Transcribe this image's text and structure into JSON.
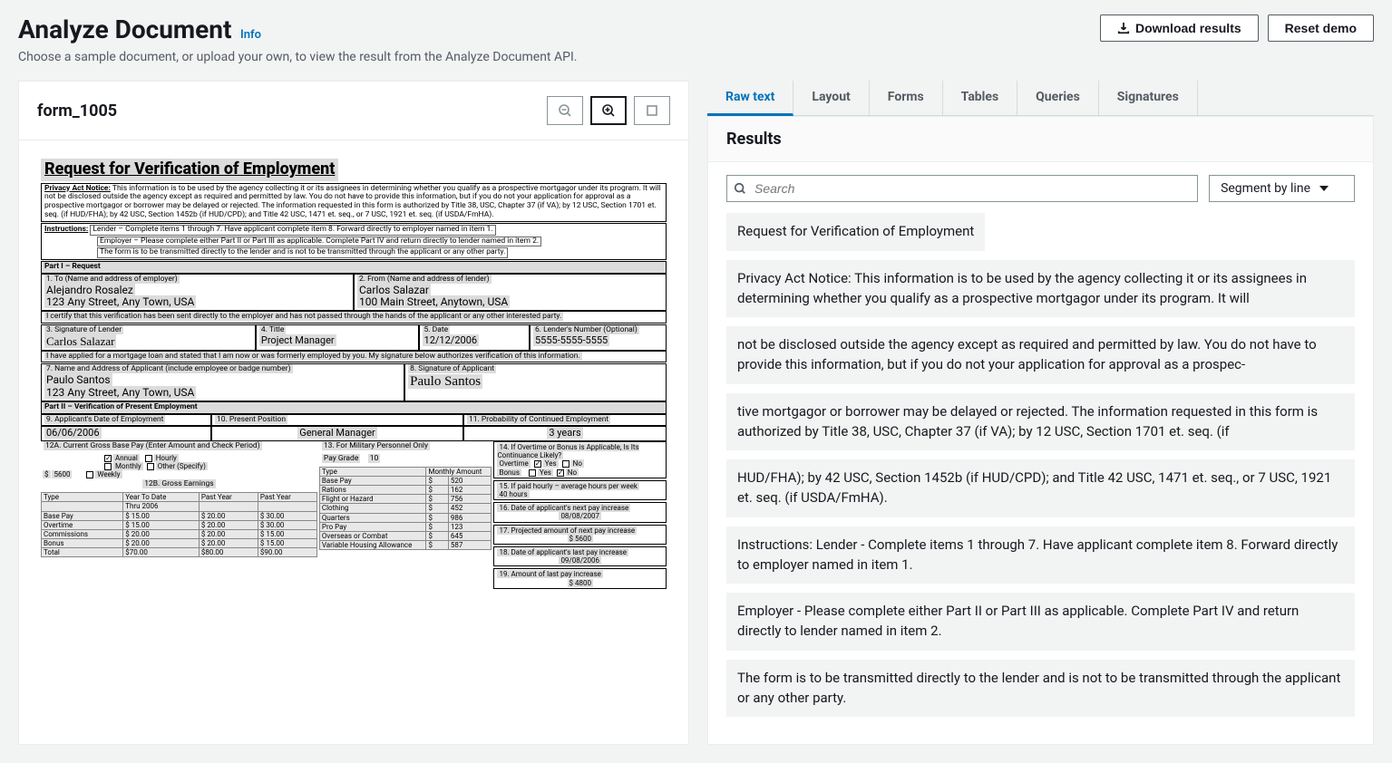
{
  "header": {
    "title": "Analyze Document",
    "info_label": "Info",
    "subtitle": "Choose a sample document, or upload your own, to view the result from the Analyze Document API.",
    "download_label": "Download results",
    "reset_label": "Reset demo"
  },
  "left": {
    "doc_name": "form_1005"
  },
  "document": {
    "title": "Request for Verification of Employment",
    "privacy_label": "Privacy Act Notice:",
    "privacy_text": "This information is to be used by the agency collecting it or its assignees in determining whether you qualify as a prospective mortgagor under its program. It will not be disclosed outside the agency except as required and permitted by law. You do not have to provide this information, but if you do not your application for approval as a prospective mortgagor or borrower may be delayed or rejected. The information requested in this form is authorized by Title 38, USC, Chapter 37 (if VA); by 12 USC, Section 1701 et. seq. (if HUD/FHA); by 42 USC, Section 1452b (if HUD/CPD); and Title 42 USC, 1471 et. seq., or 7 USC, 1921 et. seq. (if USDA/FmHA).",
    "instructions_label": "Instructions:",
    "instr_lender": "Lender – Complete items 1 through 7. Have applicant complete item 8. Forward directly to employer named in item 1.",
    "instr_employer": "Employer – Please complete either Part II or Part III as applicable. Complete Part IV and return directly to lender named in item 2.",
    "instr_form": "The form is to be transmitted directly to the lender and is not to be transmitted through the applicant or any other party.",
    "part1_label": "Part I – Request",
    "f1_label": "1. To (Name and address of employer)",
    "f1_name": "Alejandro Rosalez",
    "f1_addr": "123 Any Street, Any Town, USA",
    "f2_label": "2. From (Name and address of lender)",
    "f2_name": "Carlos Salazar",
    "f2_addr": "100 Main Street, Anytown, USA",
    "cert_text": "I certify that this verification has been sent directly to the employer and has not passed through the hands of the applicant or any other interested party.",
    "f3_label": "3. Signature of Lender",
    "f3_sig": "Carlos Salazar",
    "f4_label": "4. Title",
    "f4_val": "Project Manager",
    "f5_label": "5. Date",
    "f5_val": "12/12/2006",
    "f6_label": "6. Lender's Number (Optional)",
    "f6_val": "5555-5555-5555",
    "applied_text": "I have applied for a mortgage loan and stated that I am now or was formerly employed by you. My signature below authorizes verification of this information.",
    "f7_label": "7. Name and Address of Applicant (include employee or badge number)",
    "f7_name": "Paulo Santos",
    "f7_addr": "123 Any Street, Any Town, USA",
    "f8_label": "8. Signature of Applicant",
    "f8_sig": "Paulo Santos",
    "part2_label": "Part II – Verification of Present Employment",
    "f9_label": "9. Applicant's Date of Employment",
    "f9_val": "06/06/2006",
    "f10_label": "10. Present Position",
    "f10_val": "General Manager",
    "f11_label": "11. Probability of Continued Employment",
    "f11_val": "3 years",
    "f12a_label": "12A. Current Gross Base Pay (Enter Amount and Check Period)",
    "cb_annual": "Annual",
    "cb_hourly": "Hourly",
    "cb_monthly": "Monthly",
    "cb_other": "Other (Specify)",
    "cb_weekly": "Weekly",
    "f12a_amount": "5600",
    "f12b_label": "12B. Gross Earnings",
    "col_type": "Type",
    "col_ytd": "Year To Date",
    "col_past": "Past Year",
    "col_past2": "Past Year",
    "ytd_thru": "Thru",
    "ytd_year": "2006",
    "row_basepay": "Base Pay",
    "bp_ytd": "15.00",
    "bp_py1": "20.00",
    "bp_py2": "30.00",
    "row_overtime": "Overtime",
    "ot_ytd": "15.00",
    "ot_py1": "20.00",
    "ot_py2": "30.00",
    "row_comm": "Commissions",
    "cm_ytd": "20.00",
    "cm_py1": "20.00",
    "cm_py2": "15.00",
    "row_bonus": "Bonus",
    "bn_ytd": "20.00",
    "bn_py1": "20.00",
    "bn_py2": "15.00",
    "row_total": "Total",
    "tt_ytd": "70.00",
    "tt_py1": "80.00",
    "tt_py2": "90.00",
    "f13_label": "13. For Military Personnel Only",
    "pg_label": "Pay Grade",
    "pg_val": "10",
    "mil_type": "Type",
    "mil_ma": "Monthly Amount",
    "mil_basepay": "Base Pay",
    "mil_bp_v": "520",
    "mil_rations": "Rations",
    "mil_ra_v": "162",
    "mil_flight": "Flight or Hazard",
    "mil_fh_v": "756",
    "mil_clothing": "Clothing",
    "mil_cl_v": "452",
    "mil_quarters": "Quarters",
    "mil_qt_v": "986",
    "mil_propay": "Pro Pay",
    "mil_pp_v": "123",
    "mil_overseas": "Overseas or Combat",
    "mil_oc_v": "645",
    "mil_vha": "Variable Housing Allowance",
    "mil_vha_v": "587",
    "f14_label": "14. If Overtime or Bonus is Applicable, Is Its Continuance Likely?",
    "f14_ot": "Overtime",
    "f14_bn": "Bonus",
    "yes": "Yes",
    "no": "No",
    "f15_label": "15. If paid hourly – average hours per week",
    "f15_val": "40 hours",
    "f16_label": "16. Date of applicant's next pay increase",
    "f16_val": "08/08/2007",
    "f17_label": "17. Projected amount of next pay increase",
    "f17_val": "$ 5600",
    "f18_label": "18. Date of applicant's last pay increase",
    "f18_val": "09/08/2006",
    "f19_label": "19. Amount of last pay increase",
    "f19_val": "$ 4800"
  },
  "tabs": {
    "raw": "Raw text",
    "layout": "Layout",
    "forms": "Forms",
    "tables": "Tables",
    "queries": "Queries",
    "signatures": "Signatures"
  },
  "results": {
    "header": "Results",
    "search_placeholder": "Search",
    "segment_label": "Segment by line",
    "items": [
      "Request for Verification of Employment",
      "Privacy Act Notice: This information is to be used by the agency collecting it or its assignees in determining whether you qualify as a prospective mortgagor under its program. It will",
      "not be disclosed outside the agency except as required and permitted by law. You do not have to provide this information, but if you do not your application for approval as a prospec-",
      "tive mortgagor or borrower may be delayed or rejected. The information requested in this form is authorized by Title 38, USC, Chapter 37 (if VA); by 12 USC, Section 1701 et. seq. (if",
      "HUD/FHA); by 42 USC, Section 1452b (if HUD/CPD); and Title 42 USC, 1471 et. seq., or 7 USC, 1921 et. seq. (if USDA/FmHA).",
      "Instructions: Lender - Complete items 1 through 7. Have applicant complete item 8. Forward directly to employer named in item 1.",
      "Employer - Please complete either Part II or Part III as applicable. Complete Part IV and return directly to lender named in item 2.",
      "The form is to be transmitted directly to the lender and is not to be transmitted through the applicant or any other party."
    ]
  }
}
